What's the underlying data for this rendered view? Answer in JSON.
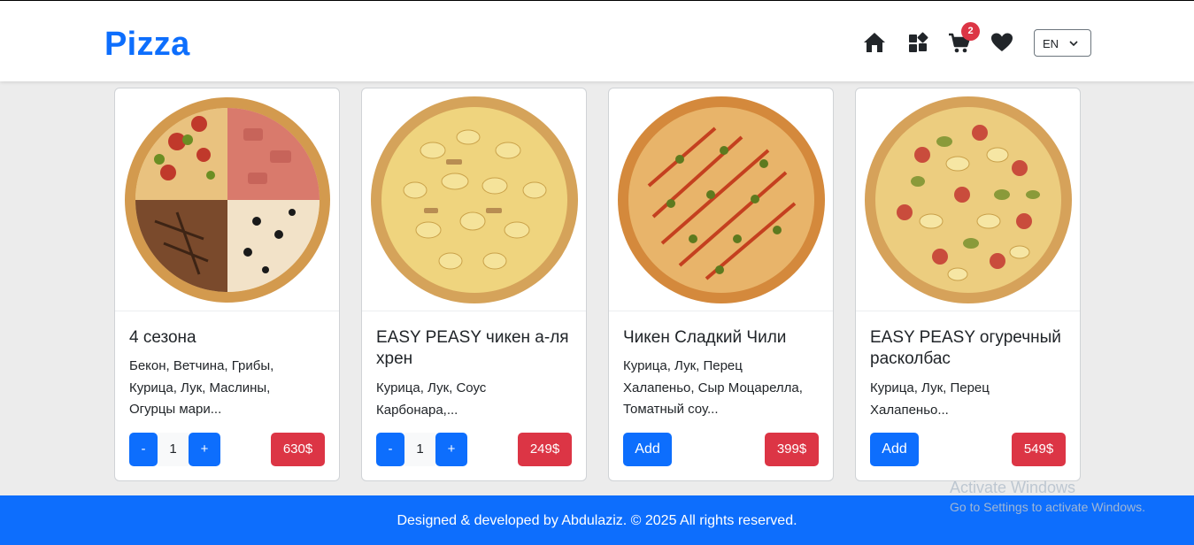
{
  "header": {
    "logo": "Pizza",
    "cart_count": "2",
    "language": "EN",
    "icons": [
      "home-icon",
      "categories-icon",
      "cart-icon",
      "heart-icon",
      "chevron-down-icon"
    ]
  },
  "products": [
    {
      "title": "4 сезона",
      "desc_lines": [
        "Бекон, Ветчина, Грибы,",
        "Курица, Лук, Маслины,",
        "Огурцы мари..."
      ],
      "price": "630$",
      "control": "stepper",
      "minus_label": "-",
      "quantity": "1",
      "plus_label": "+"
    },
    {
      "title": "EASY PEASY чикен а-ля хрен",
      "desc_lines": [
        "Курица, Лук, Соус",
        "Карбонара,..."
      ],
      "price": "249$",
      "control": "stepper",
      "minus_label": "-",
      "quantity": "1",
      "plus_label": "+"
    },
    {
      "title": "Чикен Сладкий Чили",
      "desc_lines": [
        "Курица, Лук, Перец",
        "Халапеньо, Сыр Моцарелла,",
        "Томатный соу..."
      ],
      "price": "399$",
      "control": "add",
      "add_label": "Add"
    },
    {
      "title": "EASY PEASY огуречный расколбас",
      "desc_lines": [
        "Курица, Лук, Перец",
        "Халапеньо..."
      ],
      "price": "549$",
      "control": "add",
      "add_label": "Add"
    }
  ],
  "footer": {
    "text": "Designed & developed by Abdulaziz. © 2025 All rights reserved."
  },
  "watermark": {
    "title": "Activate Windows",
    "subtitle": "Go to Settings to activate Windows."
  },
  "colors": {
    "primary": "#0d6efd",
    "danger": "#dc3545",
    "background": "#ececec"
  }
}
